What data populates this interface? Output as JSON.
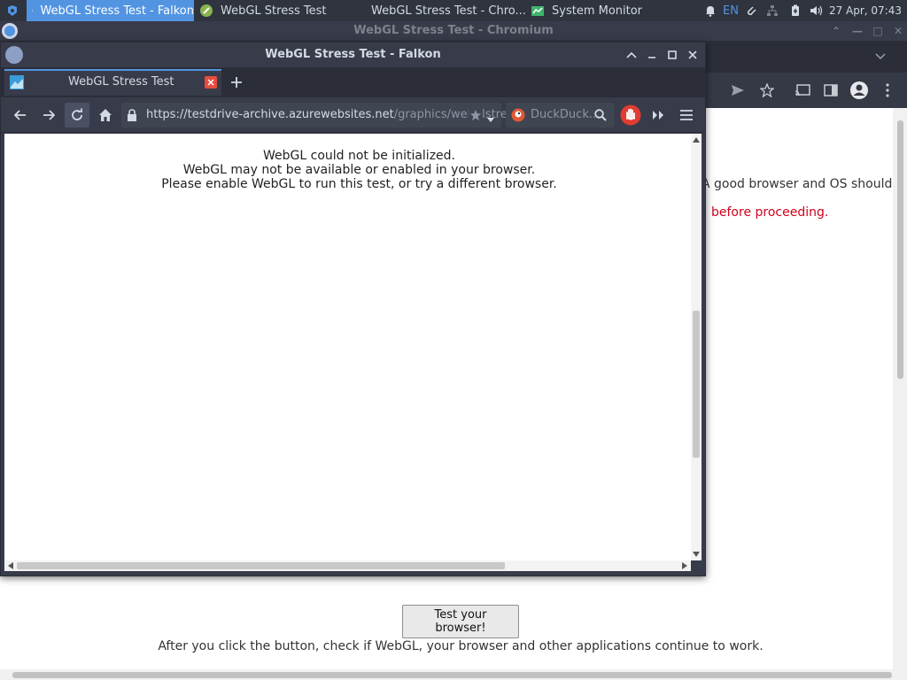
{
  "taskbar": {
    "tasks": [
      {
        "label": "WebGL Stress Test - Falkon",
        "icon": "falkon-icon"
      },
      {
        "label": "WebGL Stress Test",
        "icon": "webgl-icon"
      },
      {
        "label": "WebGL Stress Test - Chro...",
        "icon": "chromium-icon"
      },
      {
        "label": "System Monitor",
        "icon": "system-monitor-icon"
      }
    ],
    "lang": "EN",
    "clock": "27 Apr, 07:43"
  },
  "chromium": {
    "title": "WebGL Stress Test - Chromium",
    "page": {
      "text_line1": "A good browser and OS should",
      "text_line2": "before proceeding.",
      "button_label": "Test your browser!",
      "after_text": "After you click the button, check if WebGL, your browser and other applications continue to work."
    }
  },
  "falkon": {
    "title": "WebGL Stress Test - Falkon",
    "tab_label": "WebGL Stress Test",
    "url_host": "https://testdrive-archive.azurewebsites.net",
    "url_path": "/graphics/webglstress",
    "search_placeholder": "DuckDuck...",
    "message": [
      "WebGL could not be initialized.",
      "WebGL may not be available or enabled in your browser.",
      "Please enable WebGL to run this test, or try a different browser."
    ]
  },
  "colors": {
    "accent": "#5294e2",
    "panel": "#2f343f",
    "window": "#383c4a",
    "link_red": "#d0021b"
  }
}
